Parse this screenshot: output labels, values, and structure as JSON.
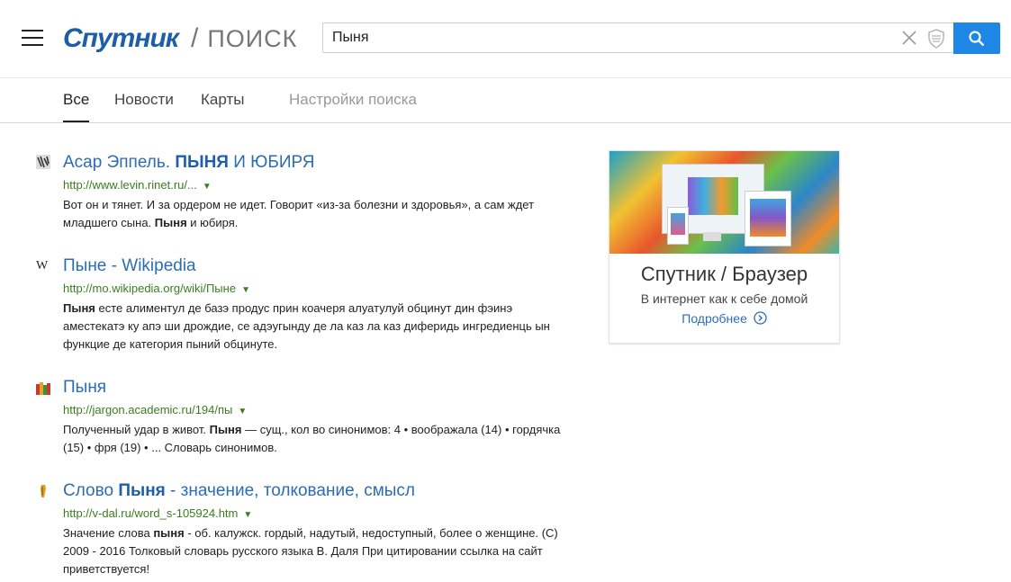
{
  "header": {
    "logo_brand": "Спутник",
    "logo_separator": "/",
    "logo_sub": "ПОИСК",
    "search_value": "Пыня"
  },
  "tabs": [
    {
      "label": "Все",
      "active": true
    },
    {
      "label": "Новости"
    },
    {
      "label": "Карты"
    },
    {
      "label": "Настройки поиска"
    }
  ],
  "results": [
    {
      "title_parts": [
        "Асар Эппель. ",
        "ПЫНЯ",
        " И ЮБИРЯ"
      ],
      "url": "http://www.levin.rinet.ru/...",
      "snippet_parts": [
        "Вот он и тянет. И за ордером не идет. Говорит «из-за болезни и здоровья», а сам ждет младшего сына. ",
        "Пыня",
        " и юбиря."
      ]
    },
    {
      "title_parts": [
        "Пыне - Wikipedia"
      ],
      "url": "http://mo.wikipedia.org/wiki/Пыне",
      "snippet_parts": [
        "Пыня",
        " есте алиментул де базэ продус прин коачеря алуатулуй обцинут дин фэинэ аместекатэ ку апэ ши дрождие, се адэугынду де ла каз ла каз диферидь ингредиенць ын функцие де категория пыний обцинуте."
      ]
    },
    {
      "title_parts": [
        "Пыня"
      ],
      "url": "http://jargon.academic.ru/194/пы",
      "snippet_parts": [
        "Полученный удар в живот. ",
        "Пыня",
        " — сущ., кол во синонимов: 4 • воображала (14) • гордячка (15) • фря (19) • ... Словарь синонимов."
      ]
    },
    {
      "title_parts": [
        "Слово ",
        "Пыня",
        " - значение, толкование, смысл"
      ],
      "url": "http://v-dal.ru/word_s-105924.htm",
      "snippet_parts": [
        "Значение слова ",
        "пыня",
        " - об. калужск. гордый, надутый, недоступный, более о женщине. (C) 2009 - 2016 Толковый словарь русского языка В. Даля При цитировании ссылка на сайт приветствуется!"
      ]
    }
  ],
  "ad": {
    "title": "Спутник / Браузер",
    "text": "В интернет как к себе домой",
    "link": "Подробнее"
  }
}
